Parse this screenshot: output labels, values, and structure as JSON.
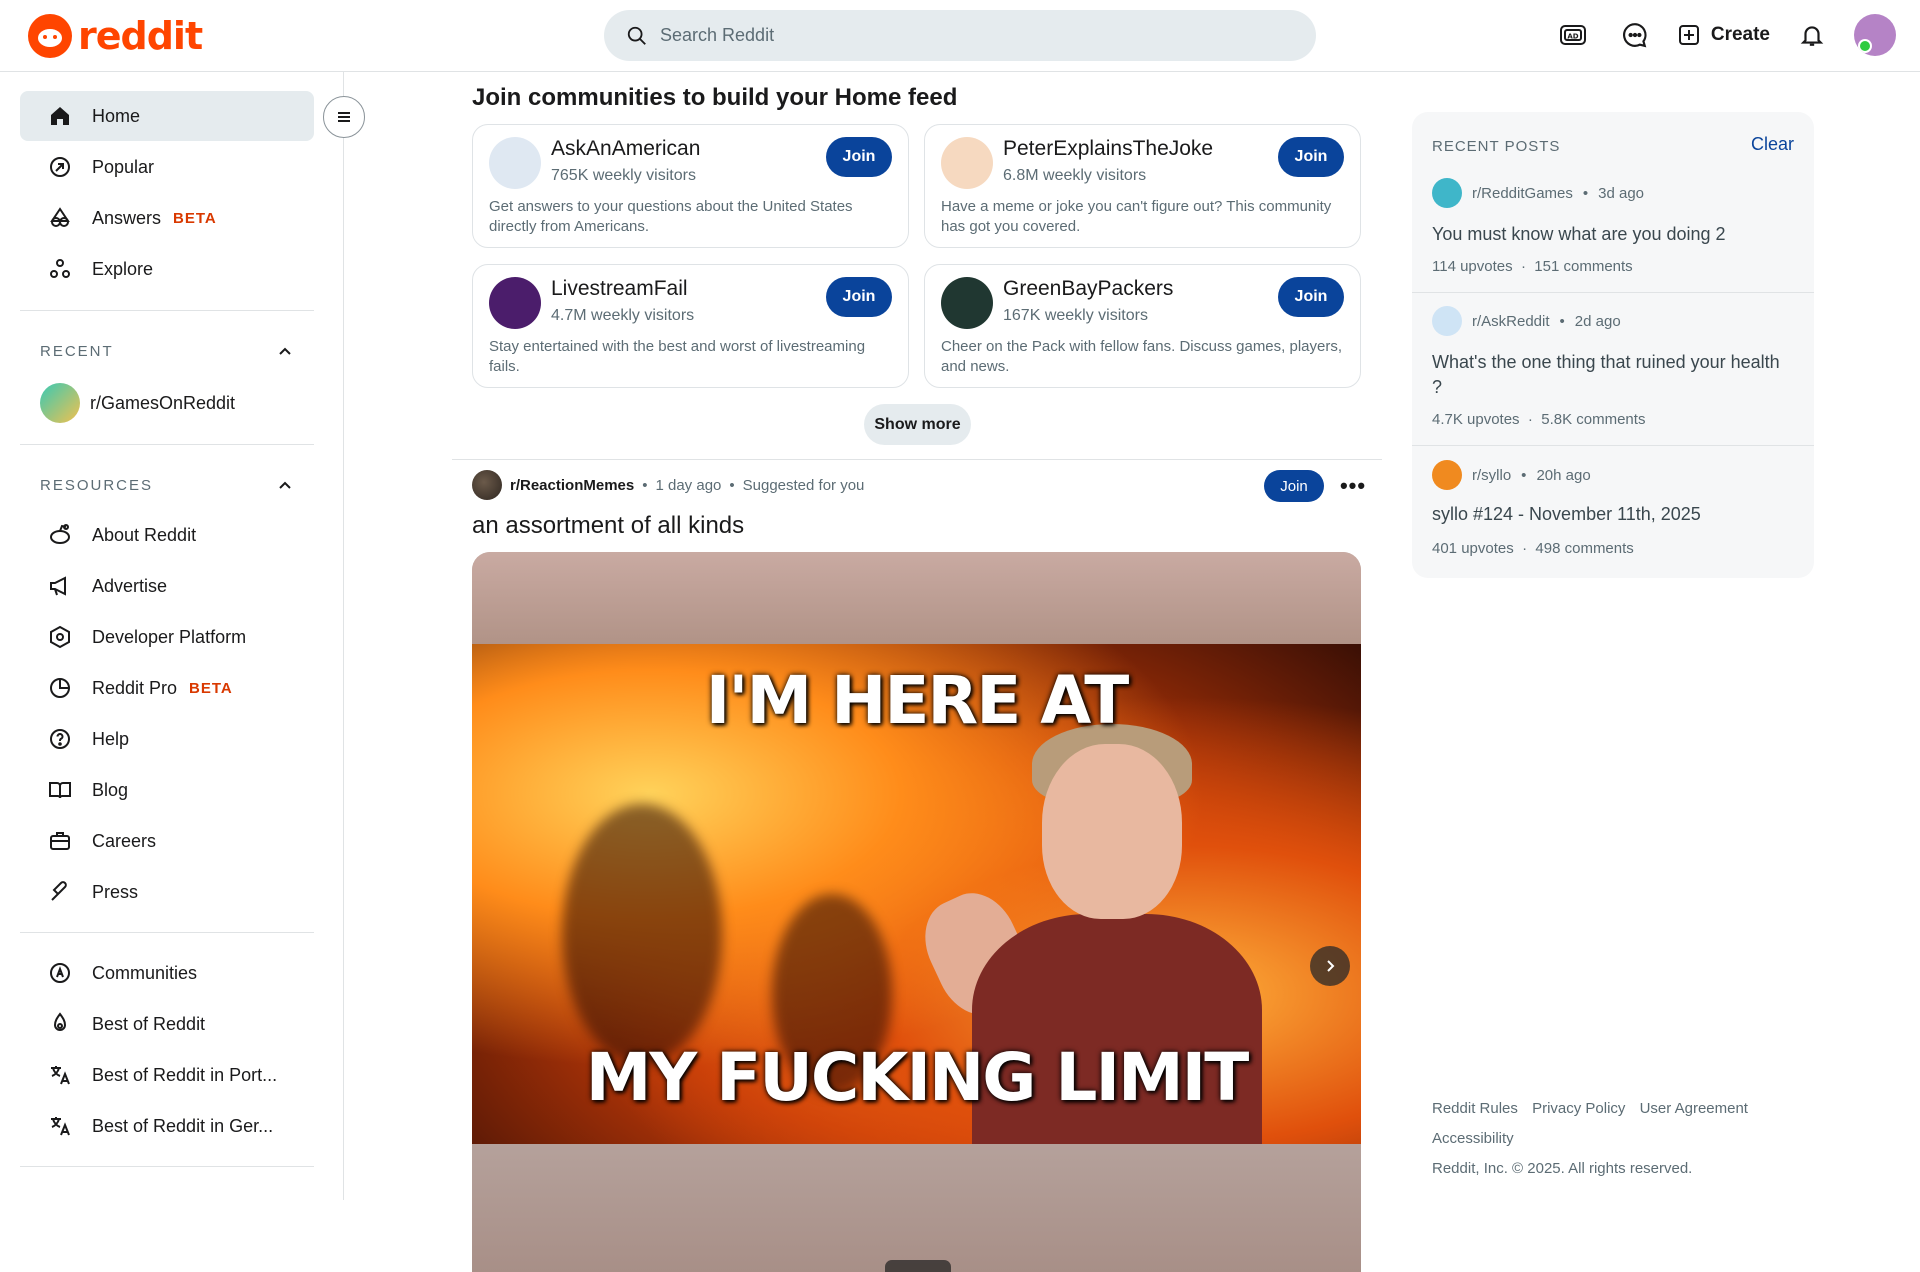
{
  "header": {
    "logo_text": "reddit",
    "search_placeholder": "Search Reddit",
    "create_label": "Create"
  },
  "sidebar": {
    "nav": [
      {
        "label": "Home",
        "icon": "home-icon"
      },
      {
        "label": "Popular",
        "icon": "popular-icon"
      },
      {
        "label": "Answers",
        "icon": "answers-icon",
        "badge": "BETA"
      },
      {
        "label": "Explore",
        "icon": "explore-icon"
      }
    ],
    "recent_heading": "RECENT",
    "recent": [
      {
        "label": "r/GamesOnReddit"
      }
    ],
    "resources_heading": "RESOURCES",
    "resources": [
      {
        "label": "About Reddit",
        "icon": "reddit-alien-icon"
      },
      {
        "label": "Advertise",
        "icon": "megaphone-icon"
      },
      {
        "label": "Developer Platform",
        "icon": "developer-icon"
      },
      {
        "label": "Reddit Pro",
        "icon": "pro-icon",
        "badge": "BETA"
      },
      {
        "label": "Help",
        "icon": "help-icon"
      },
      {
        "label": "Blog",
        "icon": "book-icon"
      },
      {
        "label": "Careers",
        "icon": "briefcase-icon"
      },
      {
        "label": "Press",
        "icon": "press-icon"
      }
    ],
    "extra": [
      {
        "label": "Communities",
        "icon": "communities-icon"
      },
      {
        "label": "Best of Reddit",
        "icon": "best-icon"
      },
      {
        "label": "Best of Reddit in Port...",
        "icon": "translate-icon"
      },
      {
        "label": "Best of Reddit in Ger...",
        "icon": "translate-icon"
      }
    ]
  },
  "main": {
    "join_title": "Join communities to build your Home feed",
    "communities": [
      {
        "name": "AskAnAmerican",
        "visitors": "765K weekly visitors",
        "desc": "Get answers to your questions about the United States directly from Americans.",
        "join": "Join",
        "color": "#dfe8f2"
      },
      {
        "name": "PeterExplainsTheJoke",
        "visitors": "6.8M weekly visitors",
        "desc": "Have a meme or joke you can't figure out? This community has got you covered.",
        "join": "Join",
        "color": "#f6d9c0"
      },
      {
        "name": "LivestreamFail",
        "visitors": "4.7M weekly visitors",
        "desc": "Stay entertained with the best and worst of livestreaming fails.",
        "join": "Join",
        "color": "#4b1d6b"
      },
      {
        "name": "GreenBayPackers",
        "visitors": "167K weekly visitors",
        "desc": "Cheer on the Pack with fellow fans. Discuss games, players, and news.",
        "join": "Join",
        "color": "#203731"
      }
    ],
    "show_more": "Show more",
    "post": {
      "subreddit": "r/ReactionMemes",
      "time": "1 day ago",
      "reason": "Suggested for you",
      "join": "Join",
      "more": "•••",
      "title": "an assortment of all kinds",
      "meme_top": "I'M HERE AT",
      "meme_bottom": "MY FUCKING LIMIT"
    }
  },
  "recent_posts": {
    "heading": "RECENT POSTS",
    "clear": "Clear",
    "items": [
      {
        "sub": "r/RedditGames",
        "time": "3d ago",
        "title": "You must know what are you doing 2",
        "upvotes": "114 upvotes",
        "comments": "151 comments",
        "color": "#3fb6c9"
      },
      {
        "sub": "r/AskReddit",
        "time": "2d ago",
        "title": "What's the one thing that ruined your health ?",
        "upvotes": "4.7K upvotes",
        "comments": "5.8K comments",
        "color": "#cfe4f5"
      },
      {
        "sub": "r/syllo",
        "time": "20h ago",
        "title": "syllo #124 - November 11th, 2025",
        "upvotes": "401 upvotes",
        "comments": "498 comments",
        "color": "#f08a1f"
      }
    ]
  },
  "footer": {
    "links": [
      "Reddit Rules",
      "Privacy Policy",
      "User Agreement",
      "Accessibility"
    ],
    "copyright": "Reddit, Inc. © 2025. All rights reserved."
  },
  "colors": {
    "brand": "#ff4500",
    "join_button": "#0a449b",
    "beta": "#d93900"
  }
}
